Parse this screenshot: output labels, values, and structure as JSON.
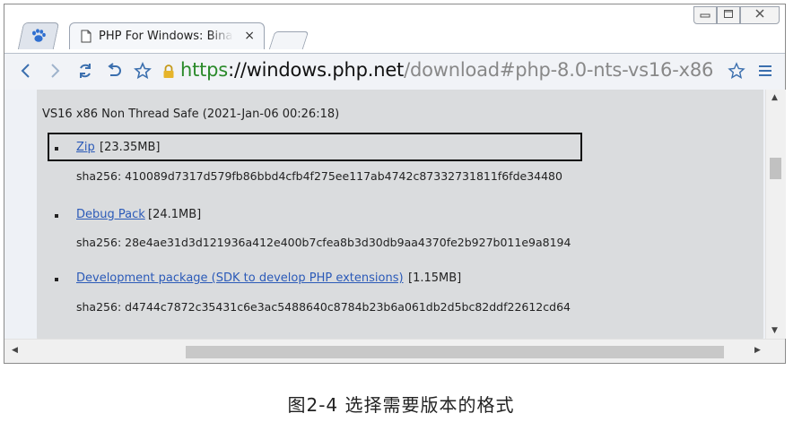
{
  "browser": {
    "tab": {
      "title": "PHP For Windows: Binar",
      "close": "×"
    },
    "url": {
      "protocol": "https",
      "host": "://windows.php.net",
      "path": "/download#php-8.0-nts-vs16-x86"
    }
  },
  "page": {
    "heading": "VS16 x86 Non Thread Safe (2021-Jan-06 00:26:18)",
    "items": [
      {
        "link": "Zip",
        "size": " [23.35MB]",
        "hash": "sha256: 410089d7317d579fb86bbd4cfb4f275ee117ab4742c87332731811f6fde34480"
      },
      {
        "link": "Debug Pack",
        "size": " [24.1MB]",
        "hash": "sha256: 28e4ae31d3d121936a412e400b7cfea8b3d30db9aa4370fe2b927b011e9a8194"
      },
      {
        "link": "Development package (SDK to develop PHP extensions)",
        "size": " [1.15MB]",
        "hash": "sha256: d4744c7872c35431c6e3ac5488640c8784b23b6a061db2d5bc82ddf22612cd64"
      }
    ]
  },
  "caption": "图2-4   选择需要版本的格式",
  "colors": {
    "link": "#2b5ab8",
    "https": "#2a8a2a",
    "content_bg": "#dadcde"
  }
}
